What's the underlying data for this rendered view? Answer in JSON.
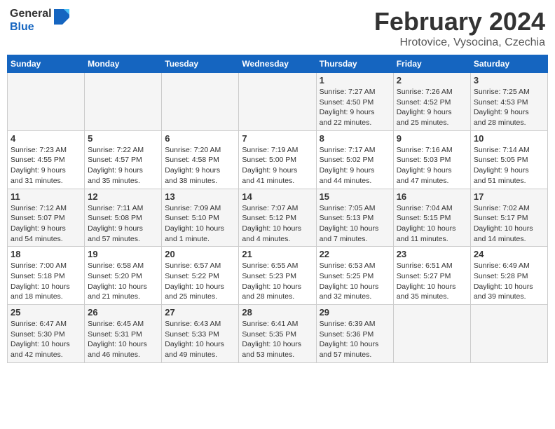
{
  "header": {
    "logo_general": "General",
    "logo_blue": "Blue",
    "month_title": "February 2024",
    "location": "Hrotovice, Vysocina, Czechia"
  },
  "days_of_week": [
    "Sunday",
    "Monday",
    "Tuesday",
    "Wednesday",
    "Thursday",
    "Friday",
    "Saturday"
  ],
  "weeks": [
    [
      {
        "day": "",
        "info": ""
      },
      {
        "day": "",
        "info": ""
      },
      {
        "day": "",
        "info": ""
      },
      {
        "day": "",
        "info": ""
      },
      {
        "day": "1",
        "info": "Sunrise: 7:27 AM\nSunset: 4:50 PM\nDaylight: 9 hours\nand 22 minutes."
      },
      {
        "day": "2",
        "info": "Sunrise: 7:26 AM\nSunset: 4:52 PM\nDaylight: 9 hours\nand 25 minutes."
      },
      {
        "day": "3",
        "info": "Sunrise: 7:25 AM\nSunset: 4:53 PM\nDaylight: 9 hours\nand 28 minutes."
      }
    ],
    [
      {
        "day": "4",
        "info": "Sunrise: 7:23 AM\nSunset: 4:55 PM\nDaylight: 9 hours\nand 31 minutes."
      },
      {
        "day": "5",
        "info": "Sunrise: 7:22 AM\nSunset: 4:57 PM\nDaylight: 9 hours\nand 35 minutes."
      },
      {
        "day": "6",
        "info": "Sunrise: 7:20 AM\nSunset: 4:58 PM\nDaylight: 9 hours\nand 38 minutes."
      },
      {
        "day": "7",
        "info": "Sunrise: 7:19 AM\nSunset: 5:00 PM\nDaylight: 9 hours\nand 41 minutes."
      },
      {
        "day": "8",
        "info": "Sunrise: 7:17 AM\nSunset: 5:02 PM\nDaylight: 9 hours\nand 44 minutes."
      },
      {
        "day": "9",
        "info": "Sunrise: 7:16 AM\nSunset: 5:03 PM\nDaylight: 9 hours\nand 47 minutes."
      },
      {
        "day": "10",
        "info": "Sunrise: 7:14 AM\nSunset: 5:05 PM\nDaylight: 9 hours\nand 51 minutes."
      }
    ],
    [
      {
        "day": "11",
        "info": "Sunrise: 7:12 AM\nSunset: 5:07 PM\nDaylight: 9 hours\nand 54 minutes."
      },
      {
        "day": "12",
        "info": "Sunrise: 7:11 AM\nSunset: 5:08 PM\nDaylight: 9 hours\nand 57 minutes."
      },
      {
        "day": "13",
        "info": "Sunrise: 7:09 AM\nSunset: 5:10 PM\nDaylight: 10 hours\nand 1 minute."
      },
      {
        "day": "14",
        "info": "Sunrise: 7:07 AM\nSunset: 5:12 PM\nDaylight: 10 hours\nand 4 minutes."
      },
      {
        "day": "15",
        "info": "Sunrise: 7:05 AM\nSunset: 5:13 PM\nDaylight: 10 hours\nand 7 minutes."
      },
      {
        "day": "16",
        "info": "Sunrise: 7:04 AM\nSunset: 5:15 PM\nDaylight: 10 hours\nand 11 minutes."
      },
      {
        "day": "17",
        "info": "Sunrise: 7:02 AM\nSunset: 5:17 PM\nDaylight: 10 hours\nand 14 minutes."
      }
    ],
    [
      {
        "day": "18",
        "info": "Sunrise: 7:00 AM\nSunset: 5:18 PM\nDaylight: 10 hours\nand 18 minutes."
      },
      {
        "day": "19",
        "info": "Sunrise: 6:58 AM\nSunset: 5:20 PM\nDaylight: 10 hours\nand 21 minutes."
      },
      {
        "day": "20",
        "info": "Sunrise: 6:57 AM\nSunset: 5:22 PM\nDaylight: 10 hours\nand 25 minutes."
      },
      {
        "day": "21",
        "info": "Sunrise: 6:55 AM\nSunset: 5:23 PM\nDaylight: 10 hours\nand 28 minutes."
      },
      {
        "day": "22",
        "info": "Sunrise: 6:53 AM\nSunset: 5:25 PM\nDaylight: 10 hours\nand 32 minutes."
      },
      {
        "day": "23",
        "info": "Sunrise: 6:51 AM\nSunset: 5:27 PM\nDaylight: 10 hours\nand 35 minutes."
      },
      {
        "day": "24",
        "info": "Sunrise: 6:49 AM\nSunset: 5:28 PM\nDaylight: 10 hours\nand 39 minutes."
      }
    ],
    [
      {
        "day": "25",
        "info": "Sunrise: 6:47 AM\nSunset: 5:30 PM\nDaylight: 10 hours\nand 42 minutes."
      },
      {
        "day": "26",
        "info": "Sunrise: 6:45 AM\nSunset: 5:31 PM\nDaylight: 10 hours\nand 46 minutes."
      },
      {
        "day": "27",
        "info": "Sunrise: 6:43 AM\nSunset: 5:33 PM\nDaylight: 10 hours\nand 49 minutes."
      },
      {
        "day": "28",
        "info": "Sunrise: 6:41 AM\nSunset: 5:35 PM\nDaylight: 10 hours\nand 53 minutes."
      },
      {
        "day": "29",
        "info": "Sunrise: 6:39 AM\nSunset: 5:36 PM\nDaylight: 10 hours\nand 57 minutes."
      },
      {
        "day": "",
        "info": ""
      },
      {
        "day": "",
        "info": ""
      }
    ]
  ]
}
